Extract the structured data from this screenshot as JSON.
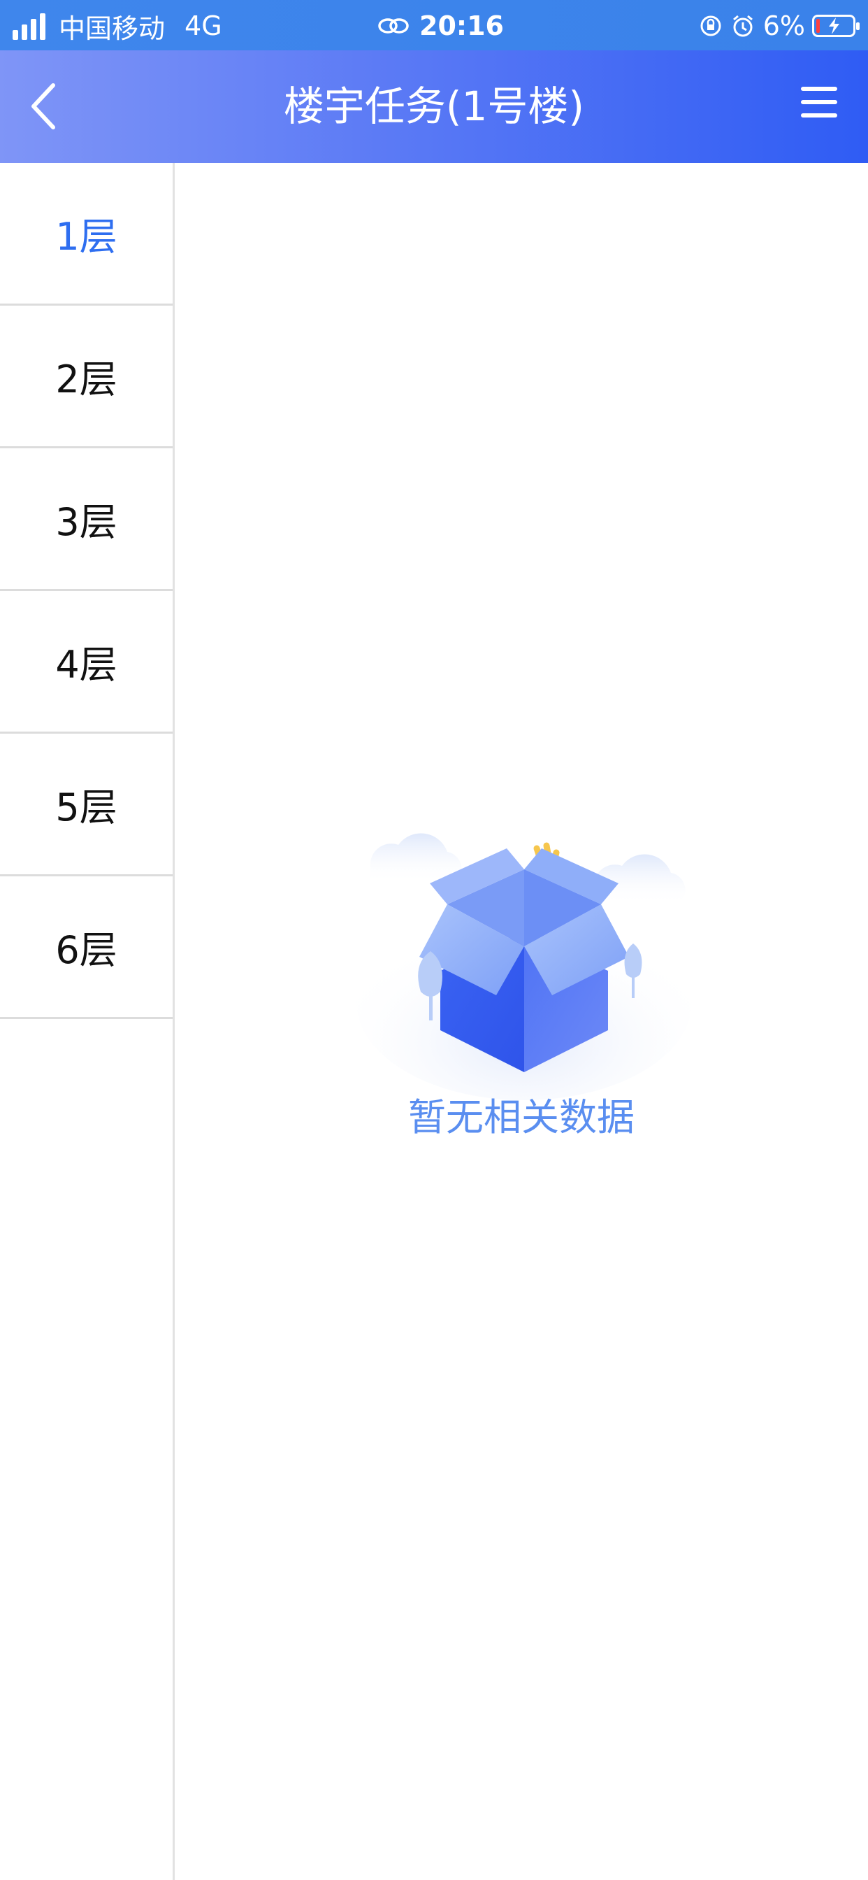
{
  "status_bar": {
    "carrier": "中国移动",
    "network": "4G",
    "time": "20:16",
    "battery": "6%"
  },
  "header": {
    "title": "楼宇任务(1号楼)",
    "back_icon": "chevron-left-icon",
    "menu_icon": "hamburger-menu-icon"
  },
  "sidebar": {
    "items": [
      {
        "label": "1层",
        "active": true
      },
      {
        "label": "2层",
        "active": false
      },
      {
        "label": "3层",
        "active": false
      },
      {
        "label": "4层",
        "active": false
      },
      {
        "label": "5层",
        "active": false
      },
      {
        "label": "6层",
        "active": false
      }
    ]
  },
  "empty_state": {
    "message": "暂无相关数据",
    "icon": "empty-box-icon"
  },
  "colors": {
    "accent": "#2e6ef0",
    "header_gradient_start": "#7f95f7",
    "header_gradient_end": "#2f5cf4",
    "status_bar": "#3f86ec",
    "empty_text": "#5a8ef0"
  }
}
